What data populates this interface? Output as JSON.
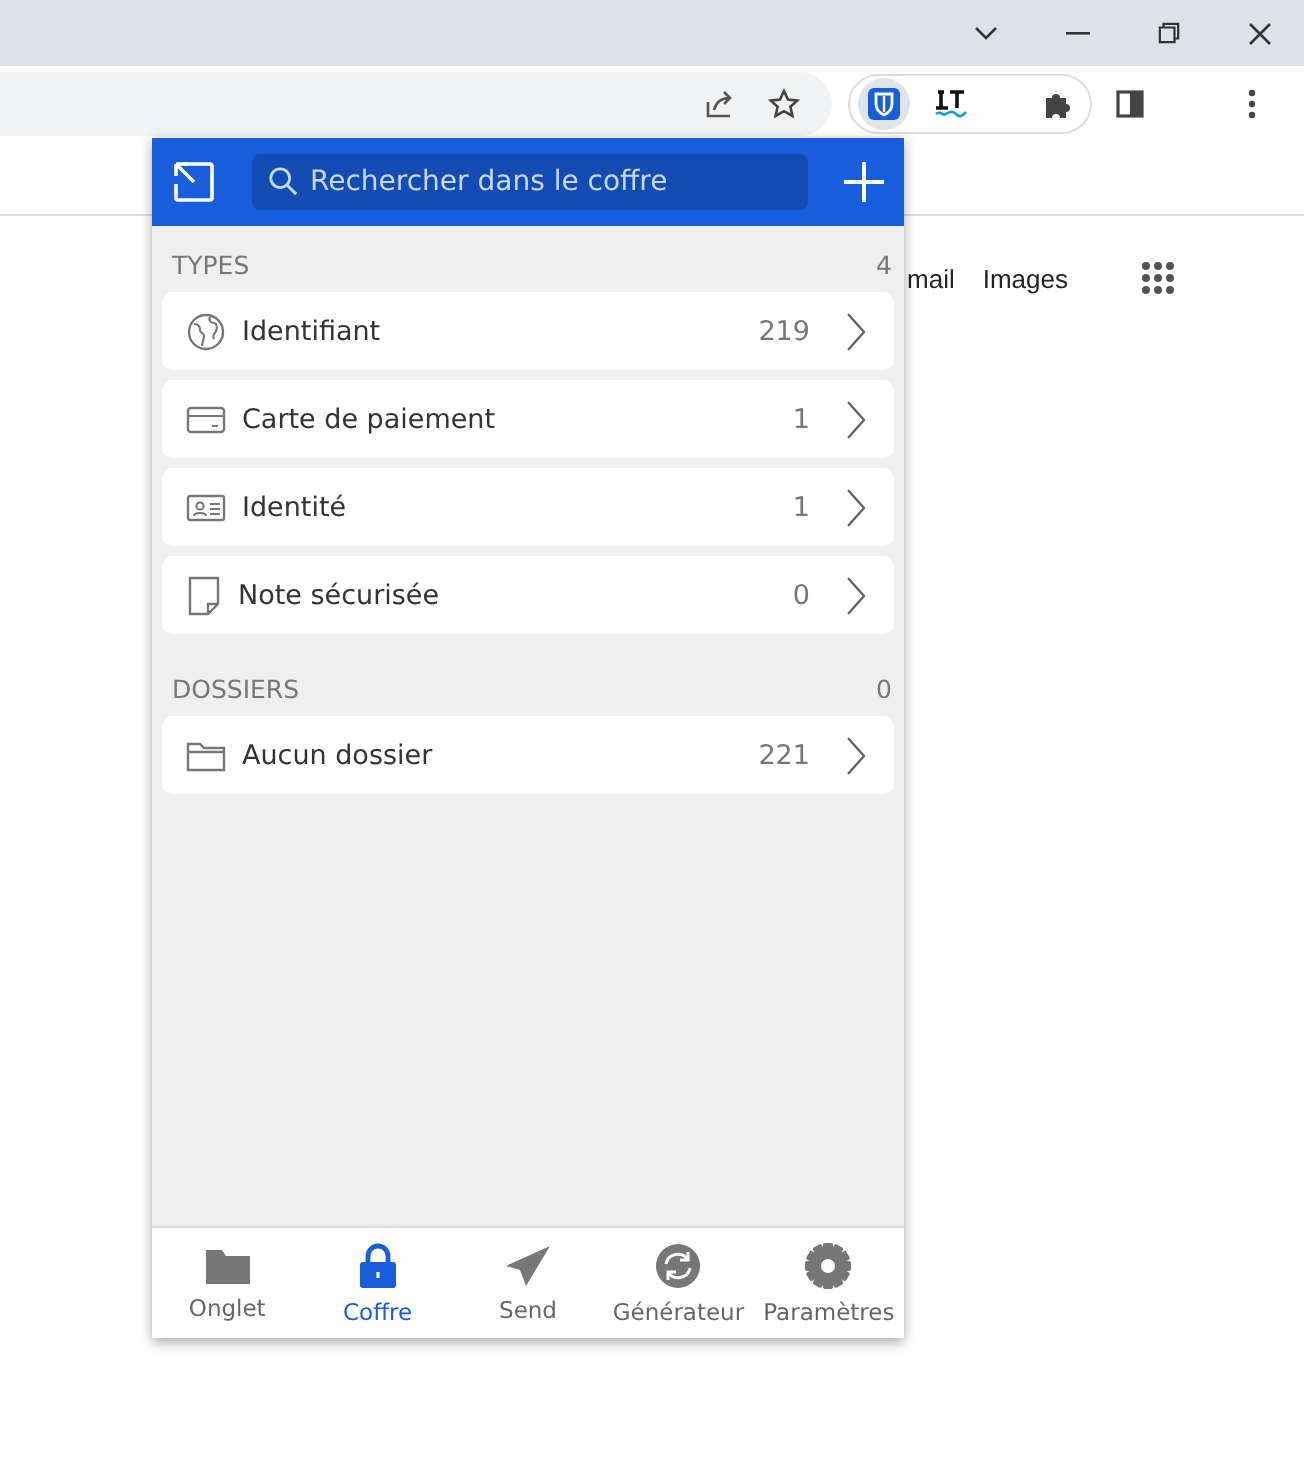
{
  "page_links": [
    "mail",
    "Images"
  ],
  "popup": {
    "search": {
      "placeholder": "Rechercher dans le coffre"
    },
    "types": {
      "title": "TYPES",
      "count": "4",
      "items": [
        {
          "kind": "login",
          "label": "Identifiant",
          "count": "219"
        },
        {
          "kind": "card",
          "label": "Carte de paiement",
          "count": "1"
        },
        {
          "kind": "identity",
          "label": "Identité",
          "count": "1"
        },
        {
          "kind": "note",
          "label": "Note sécurisée",
          "count": "0"
        }
      ]
    },
    "folders": {
      "title": "DOSSIERS",
      "count": "0",
      "items": [
        {
          "kind": "folder",
          "label": "Aucun dossier",
          "count": "221"
        }
      ]
    },
    "nav": [
      {
        "kind": "tab",
        "label": "Onglet",
        "selected": false
      },
      {
        "kind": "vault",
        "label": "Coffre",
        "selected": true
      },
      {
        "kind": "send",
        "label": "Send",
        "selected": false
      },
      {
        "kind": "generator",
        "label": "Générateur",
        "selected": false
      },
      {
        "kind": "settings",
        "label": "Paramètres",
        "selected": false
      }
    ]
  }
}
